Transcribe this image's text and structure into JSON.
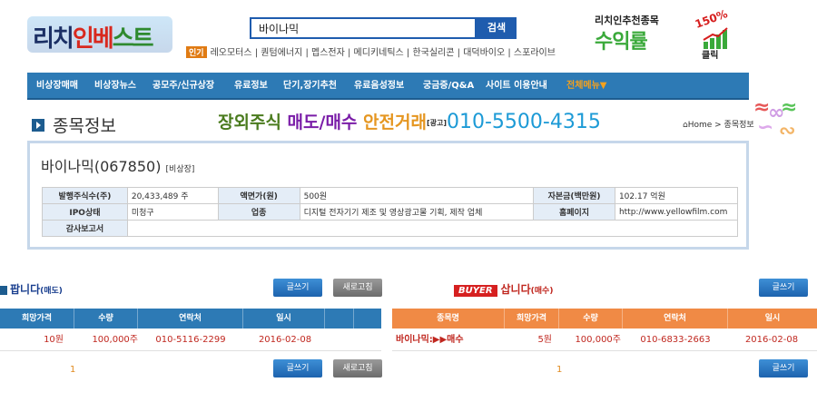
{
  "header": {
    "logo": {
      "part1": "리치",
      "part2": "인베",
      "part3": "스트"
    },
    "search": {
      "value": "바이나믹",
      "button": "검색"
    },
    "popular": {
      "tag": "인기",
      "items": "레오모터스 | 퀀텀에너지 | 멥스전자 | 메디키네틱스 | 한국실리콘 | 대덕바이오 | 스포라이브"
    },
    "promo": {
      "top": "리치인추천종목",
      "big": "수익률",
      "pct": "150%",
      "click": "클릭"
    }
  },
  "nav": {
    "items": [
      "비상장매매",
      "비상장뉴스",
      "공모주/신규상장",
      "유료정보",
      "단기,장기추천",
      "유료음성정보",
      "궁금증/Q&A",
      "사이트 이용안내"
    ],
    "all_menu": "전체메뉴▼"
  },
  "page": {
    "title": "종목정보",
    "ad": {
      "p1": "장외주식 ",
      "p2": "매도/매수 ",
      "p3": "안전거래",
      "p4": "[광고]",
      "p5": "010-5500-4315"
    },
    "breadcrumb": "Home > 종목정보"
  },
  "stock": {
    "name": "바이나믹(067850)",
    "market": "[비상장]",
    "rows": [
      {
        "h1": "발행주식수(주)",
        "v1": "20,433,489 주",
        "h2": "액면가(원)",
        "v2": "500원",
        "h3": "자본금(백만원)",
        "v3": "102.17 억원"
      },
      {
        "h1": "IPO상태",
        "v1": "미청구",
        "h2": "업종",
        "v2": "디지털 전자기기 제조 및 영상광고물 기획, 제작 업체",
        "h3": "홈페이지",
        "v3": "http://www.yellowfilm.com"
      },
      {
        "h1": "감사보고서",
        "v1": "",
        "h2": "",
        "v2": "",
        "h3": "",
        "v3": ""
      }
    ]
  },
  "sell": {
    "title": "팝니다",
    "sub": "(매도)",
    "write": "글쓰기",
    "refresh": "새로고침",
    "headers": [
      "희망가격",
      "수량",
      "연락처",
      "일시"
    ],
    "rows": [
      {
        "price": "10원",
        "qty": "100,000주",
        "contact": "010-5116-2299",
        "date": "2016-02-08"
      }
    ],
    "page": "1"
  },
  "buy": {
    "badge": "BUYER",
    "title": "삽니다",
    "sub": "(매수)",
    "write": "글쓰기",
    "headers": [
      "종목명",
      "희망가격",
      "수량",
      "연락처",
      "일시"
    ],
    "rows": [
      {
        "name": "바이나믹:▶▶매수",
        "price": "5원",
        "qty": "100,000주",
        "contact": "010-6833-2663",
        "date": "2016-02-08"
      }
    ],
    "page": "1"
  },
  "colors": {
    "nav": "#2d7ab5",
    "sell_head": "#2d7ab5",
    "buy_head": "#f08a45",
    "ad_phone": "#1c9ad6"
  }
}
